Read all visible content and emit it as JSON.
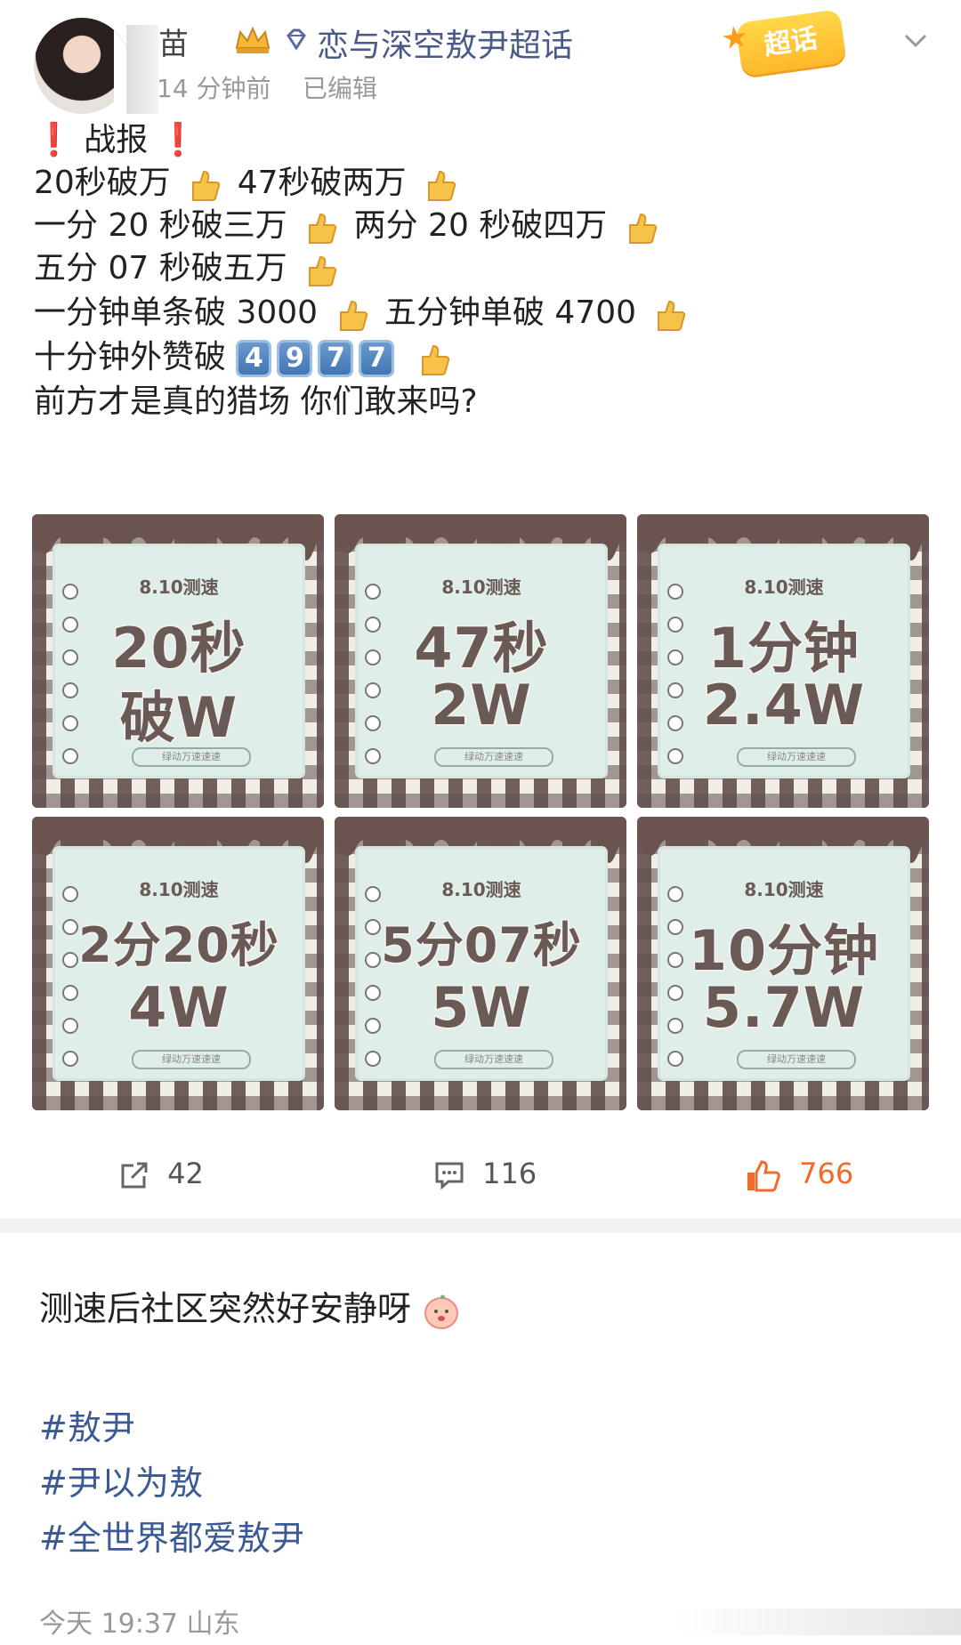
{
  "header": {
    "username": "苗",
    "topic": "恋与深空敖尹超话",
    "time": "14 分钟前",
    "edited": "已编辑",
    "badge": "超话"
  },
  "post": {
    "title": "战报",
    "lines": [
      "20秒破万",
      "47秒破两万",
      "一分 20 秒破三万",
      "两分 20 秒破四万",
      "五分 07 秒破五万",
      "一分钟单条破 3000",
      "五分钟单破 4700",
      "十分钟外赞破",
      "前方才是真的猎场 你们敢来吗?"
    ],
    "keycaps": [
      "4",
      "9",
      "7",
      "7"
    ]
  },
  "cards": [
    {
      "label": "8.10测速",
      "big1": "20秒",
      "big2": "破W",
      "foot": "绿动万速速速"
    },
    {
      "label": "8.10测速",
      "big1": "47秒",
      "big2": "2W",
      "foot": "绿动万速速速"
    },
    {
      "label": "8.10测速",
      "big1": "1分钟",
      "big2": "2.4W",
      "foot": "绿动万速速速"
    },
    {
      "label": "8.10测速",
      "big1": "2分20秒",
      "big2": "4W",
      "foot": "绿动万速速速"
    },
    {
      "label": "8.10测速",
      "big1": "5分07秒",
      "big2": "5W",
      "foot": "绿动万速速速"
    },
    {
      "label": "8.10测速",
      "big1": "10分钟",
      "big2": "5.7W",
      "foot": "绿动万速速速"
    }
  ],
  "actions": {
    "repost_count": "42",
    "comment_count": "116",
    "like_count": "766"
  },
  "repost": {
    "text": "测速后社区突然好安静呀",
    "tags": [
      "#敖尹",
      "#尹以为敖",
      "#全世界都爱敖尹"
    ],
    "footer": "今天 19:37 山东"
  },
  "colors": {
    "topic_blue": "#4a5a86",
    "tag_blue": "#3b5a95",
    "like_orange": "#f06a2a",
    "card_brown": "#6a5a56",
    "card_mint": "#dfeee9"
  }
}
